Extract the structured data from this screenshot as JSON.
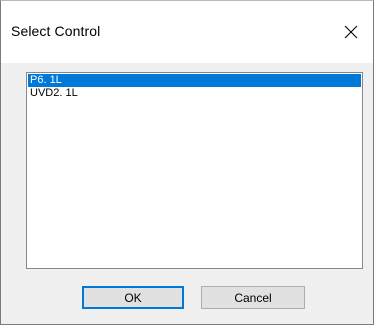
{
  "dialog": {
    "title": "Select Control"
  },
  "list": {
    "items": [
      "P6. 1L",
      "UVD2. 1L"
    ],
    "selected_index": 0
  },
  "buttons": {
    "ok_label": "OK",
    "cancel_label": "Cancel"
  },
  "icons": {
    "close": "close-icon"
  },
  "colors": {
    "selection": "#0078d7",
    "dialog_background": "#f0f0f0",
    "title_background": "#ffffff"
  }
}
